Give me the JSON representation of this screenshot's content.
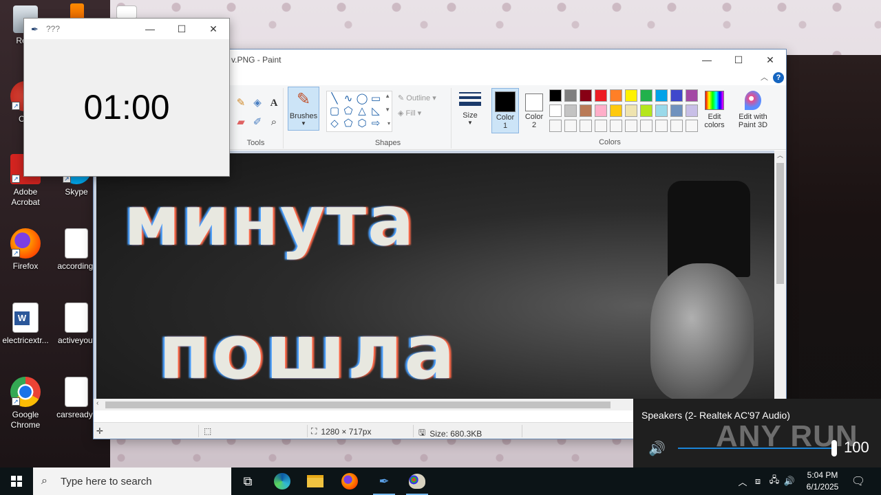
{
  "desktop": {
    "icons": [
      {
        "label": "Recy"
      },
      {
        "label": "CCl"
      },
      {
        "label": "Adobe Acrobat"
      },
      {
        "label": "Skype"
      },
      {
        "label": "Firefox"
      },
      {
        "label": "according."
      },
      {
        "label": "electricextr..."
      },
      {
        "label": "activeyout"
      },
      {
        "label": "Google Chrome"
      },
      {
        "label": "carsready.j"
      }
    ]
  },
  "timer_window": {
    "title": "???",
    "value": "01:00",
    "controls": {
      "minimize": "—",
      "maximize": "☐",
      "close": "✕"
    }
  },
  "paint": {
    "title": "v.PNG - Paint",
    "controls": {
      "minimize": "—",
      "maximize": "☐",
      "close": "✕"
    },
    "help": "?",
    "groups": {
      "tools": "Tools",
      "shapes": "Shapes",
      "colors": "Colors"
    },
    "brushes_label": "Brushes",
    "outline_label": "Outline",
    "fill_label": "Fill",
    "size_label": "Size",
    "color1_label": "Color",
    "color1_num": "1",
    "color2_label": "Color",
    "color2_num": "2",
    "edit_colors_label": "Edit",
    "edit_colors_label2": "colors",
    "edit3d_label": "Edit with",
    "edit3d_label2": "Paint 3D",
    "palette": [
      "#000000",
      "#7f7f7f",
      "#880015",
      "#ed1c24",
      "#ff7f27",
      "#fff200",
      "#22b14c",
      "#00a2e8",
      "#3f48cc",
      "#a349a4",
      "#ffffff",
      "#c3c3c3",
      "#b97a57",
      "#ffaec9",
      "#ffc90e",
      "#efe4b0",
      "#b5e61d",
      "#99d9ea",
      "#7092be",
      "#c8bfe7"
    ],
    "canvas_text_line1": "минута",
    "canvas_text_line2": "пошла",
    "status": {
      "dimensions": "1280 × 717px",
      "size": "Size: 680.3KB"
    }
  },
  "volume": {
    "device": "Speakers (2- Realtek AC'97 Audio)",
    "level": 100,
    "level_text": "100",
    "watermark": "ANY RUN"
  },
  "taskbar": {
    "search_placeholder": "Type here to search",
    "time": "5:04 PM",
    "date": "6/1/2025"
  }
}
